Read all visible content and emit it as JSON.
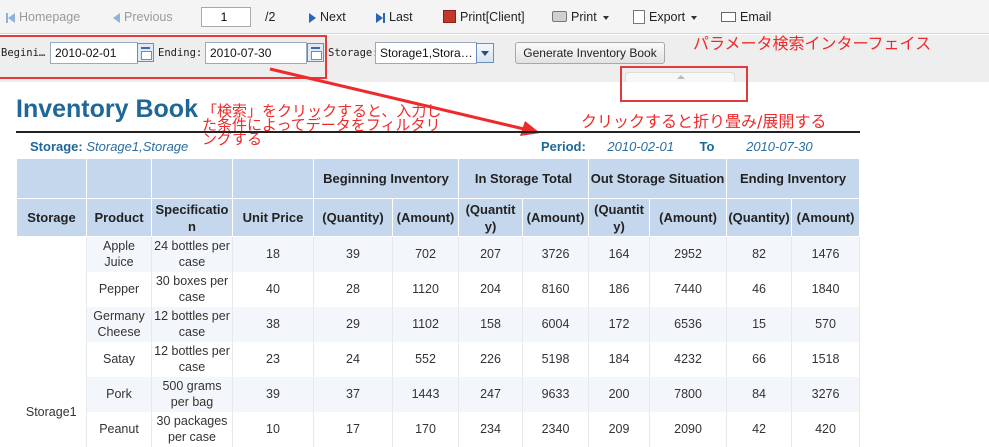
{
  "toolbar": {
    "homepage": "Homepage",
    "previous": "Previous",
    "page_value": "1",
    "page_total": "/2",
    "next": "Next",
    "last": "Last",
    "print_client": "Print[Client]",
    "print": "Print",
    "export": "Export",
    "email": "Email"
  },
  "params": {
    "beginning_label": "Begini…",
    "beginning_value": "2010-02-01",
    "ending_label": "Ending:",
    "ending_value": "2010-07-30",
    "storage_label": "Storage:",
    "storage_value": "Storage1,Stora…",
    "generate_button": "Generate Inventory Book"
  },
  "annotations": {
    "param_panel": "パラメータ検索インターフェイス",
    "collapse_toggle": "クリックすると折り畳み/展開する",
    "search_note": "「検索」をクリックすると、入力した条件によってデータをフィルタリングする"
  },
  "report": {
    "title": "Inventory Book",
    "storage_label": "Storage:",
    "storage_value": "Storage1,Storage",
    "period_label": "Period:",
    "period_from": "2010-02-01",
    "to_label": "To",
    "period_to": "2010-07-30",
    "group_headers": {
      "beginning": "Beginning Inventory",
      "in_storage": "In Storage Total",
      "out_storage": "Out Storage Situation",
      "ending": "Ending Inventory"
    },
    "columns": {
      "storage": "Storage",
      "product": "Product",
      "specification": "Specification",
      "unit_price": "Unit Price",
      "b_quantity": "(Quantity)",
      "b_amount": "(Amount)",
      "i_quantity": "(Quantity)",
      "i_amount": "(Amount)",
      "o_quantity": "(Quantity)",
      "o_amount": "(Amount)",
      "e_quantity": "(Quantity)",
      "e_amount": "(Amount)"
    },
    "storage_group": "Storage1",
    "rows": [
      [
        "Apple Juice",
        "24 bottles per case",
        "18",
        "39",
        "702",
        "207",
        "3726",
        "164",
        "2952",
        "82",
        "1476"
      ],
      [
        "Pepper",
        "30 boxes per case",
        "40",
        "28",
        "1120",
        "204",
        "8160",
        "186",
        "7440",
        "46",
        "1840"
      ],
      [
        "Germany Cheese",
        "12 bottles per case",
        "38",
        "29",
        "1102",
        "158",
        "6004",
        "172",
        "6536",
        "15",
        "570"
      ],
      [
        "Satay",
        "12 bottles per case",
        "23",
        "24",
        "552",
        "226",
        "5198",
        "184",
        "4232",
        "66",
        "1518"
      ],
      [
        "Pork",
        "500 grams per bag",
        "39",
        "37",
        "1443",
        "247",
        "9633",
        "200",
        "7800",
        "84",
        "3276"
      ],
      [
        "Peanut",
        "30 packages per case",
        "10",
        "17",
        "170",
        "234",
        "2340",
        "209",
        "2090",
        "42",
        "420"
      ]
    ]
  }
}
